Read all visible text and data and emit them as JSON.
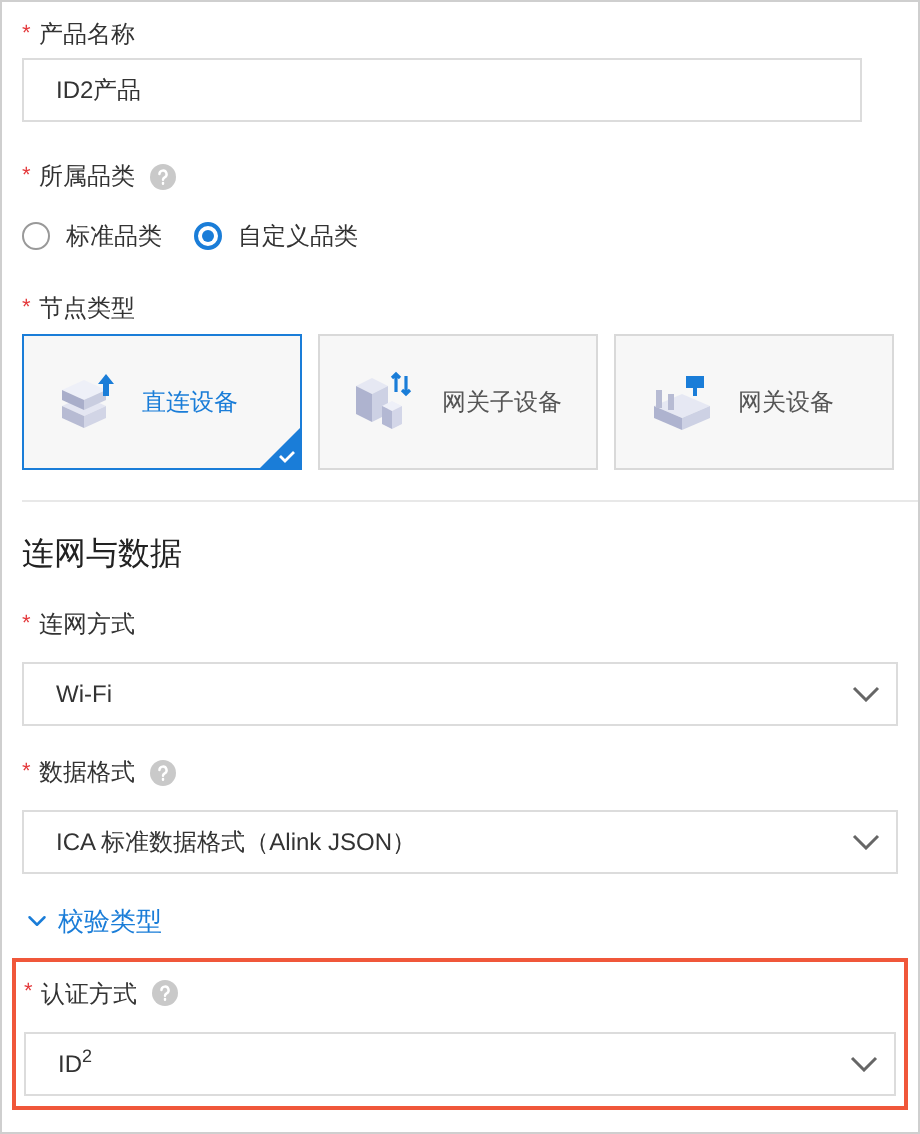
{
  "product_name": {
    "label": "产品名称",
    "required_mark": "*",
    "value": "ID2产品"
  },
  "category": {
    "label": "所属品类",
    "required_mark": "*",
    "help": true,
    "options": [
      {
        "label": "标准品类",
        "selected": false
      },
      {
        "label": "自定义品类",
        "selected": true
      }
    ]
  },
  "node_type": {
    "label": "节点类型",
    "required_mark": "*",
    "options": [
      {
        "label": "直连设备",
        "kind": "direct",
        "selected": true
      },
      {
        "label": "网关子设备",
        "kind": "subdevice",
        "selected": false
      },
      {
        "label": "网关设备",
        "kind": "gateway",
        "selected": false
      }
    ]
  },
  "section": {
    "title": "连网与数据"
  },
  "network_fields": [
    {
      "kind": "select",
      "label": "连网方式",
      "required_mark": "*",
      "help": false,
      "value": "Wi-Fi",
      "highlighted": false
    },
    {
      "kind": "select",
      "label": "数据格式",
      "required_mark": "*",
      "help": true,
      "value": "ICA 标准数据格式（Alink JSON）",
      "highlighted": false
    },
    {
      "kind": "toggle",
      "label": "校验类型",
      "expanded": true
    },
    {
      "kind": "select",
      "label": "认证方式",
      "required_mark": "*",
      "help": true,
      "value": "ID$^{2}$",
      "highlighted": true
    }
  ]
}
